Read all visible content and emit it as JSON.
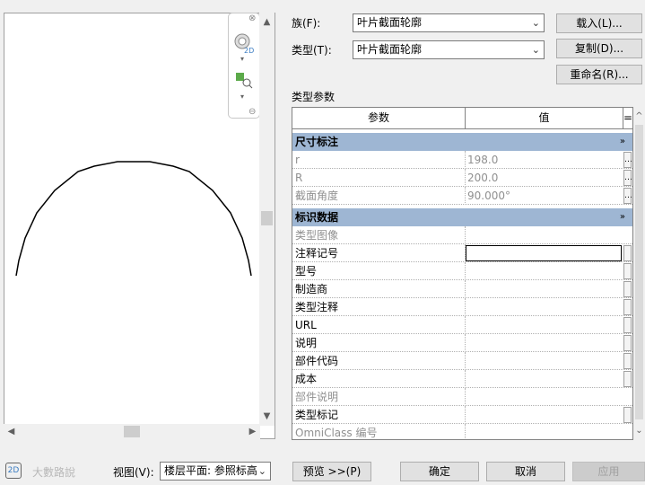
{
  "family": {
    "label": "族(F):",
    "value": "叶片截面轮廓"
  },
  "type": {
    "label": "类型(T):",
    "value": "叶片截面轮廓"
  },
  "buttons": {
    "load": "载入(L)...",
    "duplicate": "复制(D)...",
    "rename": "重命名(R)...",
    "preview": "预览 >>(P)",
    "ok": "确定",
    "cancel": "取消",
    "apply": "应用"
  },
  "type_params_label": "类型参数",
  "table": {
    "col_param": "参数",
    "col_value": "值",
    "col_eq": "=",
    "groups": [
      {
        "name": "尺寸标注",
        "collapse": "»",
        "rows": [
          {
            "name": "r",
            "value": "198.0"
          },
          {
            "name": "R",
            "value": "200.0"
          },
          {
            "name": "截面角度",
            "value": "90.000°"
          }
        ]
      },
      {
        "name": "标识数据",
        "collapse": "»",
        "rows": [
          {
            "name": "类型图像",
            "value": ""
          },
          {
            "name": "注释记号",
            "value": ""
          },
          {
            "name": "型号",
            "value": ""
          },
          {
            "name": "制造商",
            "value": ""
          },
          {
            "name": "类型注释",
            "value": ""
          },
          {
            "name": "URL",
            "value": ""
          },
          {
            "name": "说明",
            "value": ""
          },
          {
            "name": "部件代码",
            "value": ""
          },
          {
            "name": "成本",
            "value": ""
          },
          {
            "name": "部件说明",
            "value": ""
          },
          {
            "name": "类型标记",
            "value": ""
          },
          {
            "name": "OmniClass 编号",
            "value": ""
          }
        ]
      }
    ]
  },
  "view": {
    "label": "视图(V):",
    "value": "楼层平面: 参照标高"
  },
  "watermark": "大數路說",
  "nav_icons": [
    "close-icon",
    "steering-wheel-2d-icon",
    "zoom-region-icon"
  ]
}
